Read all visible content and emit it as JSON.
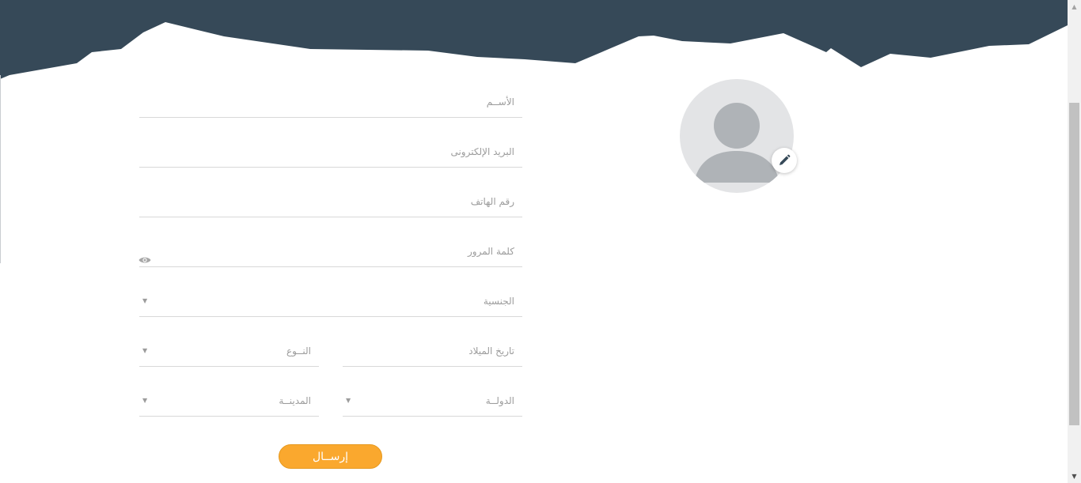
{
  "theme": {
    "header_color": "#364958",
    "accent": "#faa82e"
  },
  "form": {
    "name_placeholder": "الأســم",
    "email_placeholder": "البريد الإلكترونى",
    "phone_placeholder": "رقم الهاتف",
    "password_placeholder": "كلمة المرور",
    "nationality_placeholder": "الجنسية",
    "birthdate_placeholder": "تاريخ الميلاد",
    "gender_placeholder": "النــوع",
    "country_placeholder": "الدولــة",
    "city_placeholder": "المدينــة",
    "submit_label": "إرســال"
  },
  "icons": {
    "password_toggle": "eye-icon",
    "avatar_edit": "pencil-icon",
    "avatar": "user-silhouette-icon",
    "select_caret": "caret-down-icon"
  }
}
